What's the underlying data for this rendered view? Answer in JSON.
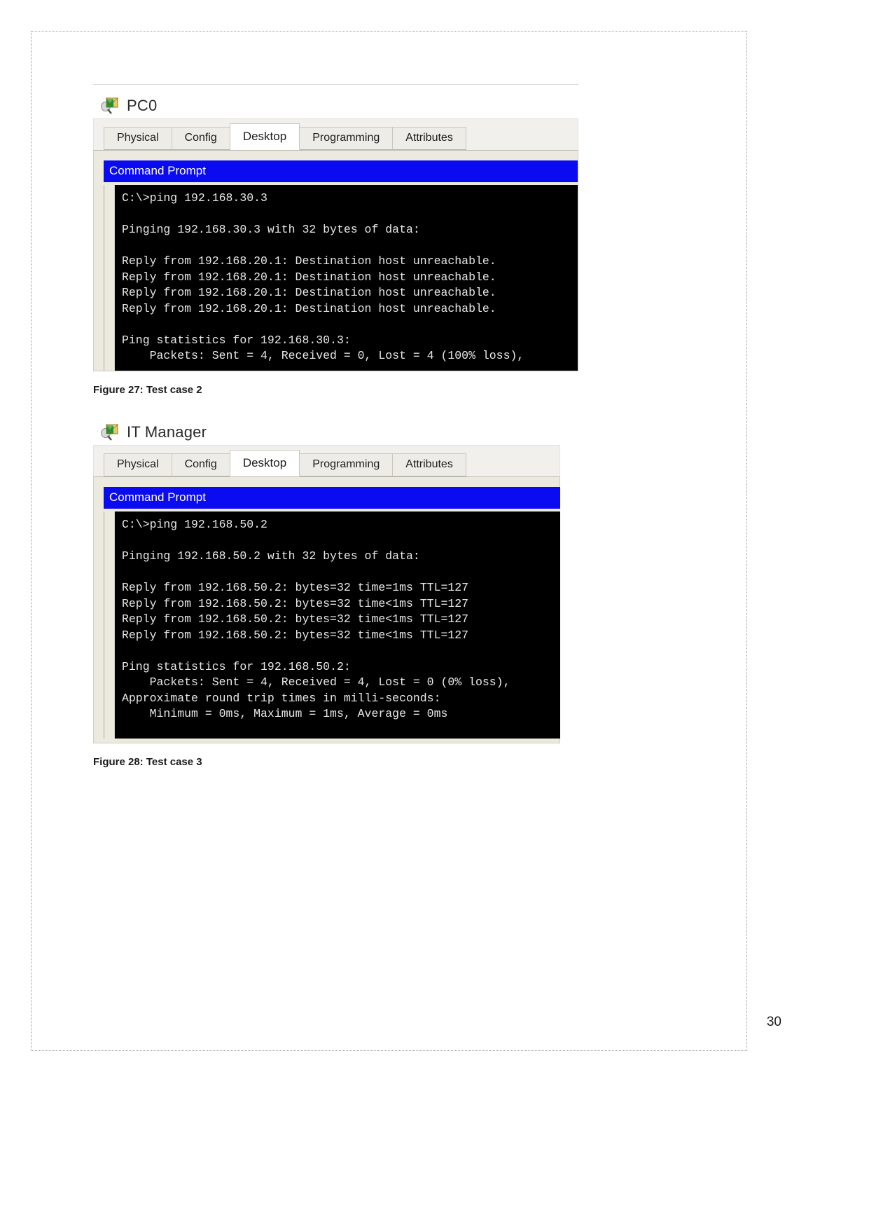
{
  "document": {
    "page_number": "30"
  },
  "figures": [
    {
      "id": "pc0",
      "window": {
        "device_icon": "packet-tracer-device-icon",
        "title": "PC0",
        "tabs": [
          {
            "label": "Physical",
            "active": false
          },
          {
            "label": "Config",
            "active": false
          },
          {
            "label": "Desktop",
            "active": true
          },
          {
            "label": "Programming",
            "active": false
          },
          {
            "label": "Attributes",
            "active": false
          }
        ],
        "terminal": {
          "titlebar": "Command Prompt",
          "titlebar_bg": "#0b0bf2",
          "screen_bg": "#000000",
          "screen_fg": "#e8e8e8",
          "lines": [
            "C:\\>ping 192.168.30.3",
            "",
            "Pinging 192.168.30.3 with 32 bytes of data:",
            "",
            "Reply from 192.168.20.1: Destination host unreachable.",
            "Reply from 192.168.20.1: Destination host unreachable.",
            "Reply from 192.168.20.1: Destination host unreachable.",
            "Reply from 192.168.20.1: Destination host unreachable.",
            "",
            "Ping statistics for 192.168.30.3:",
            "    Packets: Sent = 4, Received = 0, Lost = 4 (100% loss),"
          ]
        }
      },
      "caption": "Figure 27: Test case 2"
    },
    {
      "id": "itmanager",
      "window": {
        "device_icon": "packet-tracer-device-icon",
        "title": "IT Manager",
        "tabs": [
          {
            "label": "Physical",
            "active": false
          },
          {
            "label": "Config",
            "active": false
          },
          {
            "label": "Desktop",
            "active": true
          },
          {
            "label": "Programming",
            "active": false
          },
          {
            "label": "Attributes",
            "active": false
          }
        ],
        "terminal": {
          "titlebar": "Command Prompt",
          "titlebar_bg": "#0b0bf2",
          "screen_bg": "#000000",
          "screen_fg": "#e8e8e8",
          "lines": [
            "C:\\>ping 192.168.50.2",
            "",
            "Pinging 192.168.50.2 with 32 bytes of data:",
            "",
            "Reply from 192.168.50.2: bytes=32 time=1ms TTL=127",
            "Reply from 192.168.50.2: bytes=32 time<1ms TTL=127",
            "Reply from 192.168.50.2: bytes=32 time<1ms TTL=127",
            "Reply from 192.168.50.2: bytes=32 time<1ms TTL=127",
            "",
            "Ping statistics for 192.168.50.2:",
            "    Packets: Sent = 4, Received = 4, Lost = 0 (0% loss),",
            "Approximate round trip times in milli-seconds:",
            "    Minimum = 0ms, Maximum = 1ms, Average = 0ms"
          ]
        }
      },
      "caption": "Figure 28: Test case 3"
    }
  ]
}
